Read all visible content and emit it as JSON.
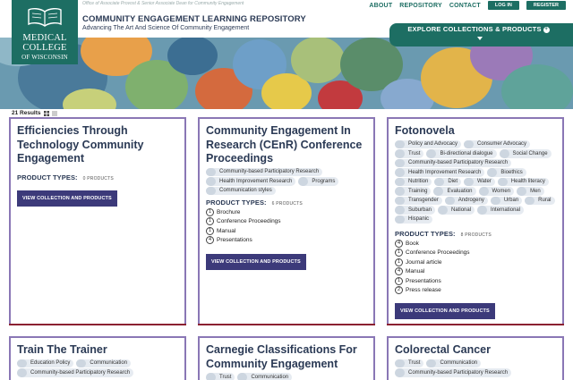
{
  "header": {
    "supra": "Office of Associate Provost & Senior Associate Dean for Community Engagement",
    "logo_line1": "MEDICAL",
    "logo_line2": "COLLEGE",
    "logo_line3": "OF WISCONSIN",
    "title": "COMMUNITY ENGAGEMENT LEARNING REPOSITORY",
    "subtitle": "Advancing The Art And Science Of Community Engagement"
  },
  "nav": {
    "about": "ABOUT",
    "repository": "REPOSITORY",
    "contact": "CONTACT",
    "login": "LOG IN",
    "register": "REGISTER"
  },
  "explore": {
    "label": "EXPLORE COLLECTIONS & PRODUCTS"
  },
  "results": {
    "count": "21 Results"
  },
  "product_types_label": "PRODUCT TYPES:",
  "view_button_label": "VIEW COLLECTION AND PRODUCTS",
  "cards": [
    {
      "title": "Efficiencies Through Technology Community Engagement",
      "tags": [],
      "count_label": "0 PRODUCTS",
      "products": []
    },
    {
      "title": "Community Engagement In Research (CEnR) Conference Proceedings",
      "tags": [
        "Community-based Participatory Research",
        "Health Improvement Research",
        "Programs",
        "Communication styles"
      ],
      "count_label": "6 PRODUCTS",
      "products": [
        {
          "n": "1",
          "name": "Brochure"
        },
        {
          "n": "1",
          "name": "Conference Proceedings"
        },
        {
          "n": "1",
          "name": "Manual"
        },
        {
          "n": "4",
          "name": "Presentations"
        }
      ]
    },
    {
      "title": "Fotonovela",
      "tags": [
        "Policy and Advocacy",
        "Consumer Advocacy",
        "Trust",
        "Bi-directional dialogue",
        "Social Change",
        "Community-based Participatory Research",
        "Health Improvement Research",
        "Bioethics",
        "Nutrition",
        "Diet",
        "Water",
        "Health literacy",
        "Training",
        "Evaluation",
        "Women",
        "Men",
        "Transgender",
        "Androgeny",
        "Urban",
        "Rural",
        "Suburban",
        "National",
        "International",
        "Hispanic"
      ],
      "count_label": "8 PRODUCTS",
      "products": [
        {
          "n": "4",
          "name": "Book"
        },
        {
          "n": "1",
          "name": "Conference Proceedings"
        },
        {
          "n": "1",
          "name": "Journal article"
        },
        {
          "n": "4",
          "name": "Manual"
        },
        {
          "n": "1",
          "name": "Presentations"
        },
        {
          "n": "2",
          "name": "Press release"
        }
      ]
    },
    {
      "title": "Train The Trainer",
      "tags": [
        "Education Policy",
        "Communication",
        "Community-based Participatory Research"
      ]
    },
    {
      "title": "Carnegie Classifications For Community Engagement",
      "tags": [
        "Trust",
        "Communication"
      ]
    },
    {
      "title": "Colorectal Cancer",
      "tags": [
        "Trust",
        "Communication",
        "Community-based Participatory Research"
      ]
    }
  ],
  "colors": {
    "brand_green": "#1d6e63",
    "card_border": "#8a77b5",
    "card_border_bottom": "#8b2131",
    "button": "#3c3a7a",
    "title_navy": "#2b3a55"
  }
}
